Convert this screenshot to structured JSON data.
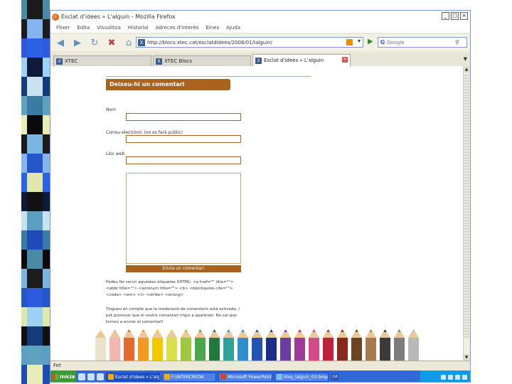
{
  "strip": {
    "colors": [
      "#4a8aa6",
      "#1c1c1c",
      "#2f5ae0",
      "#9ed2f5",
      "#163a7a",
      "#5fa2c0",
      "#e8edb8",
      "#1a1a1a",
      "#84b5f0",
      "#2b63e6",
      "#0d1a3a",
      "#c8e2f0",
      "#3a7ba3",
      "#0a0a0a",
      "#7bb6e3",
      "#2655c7",
      "#dfe8a8",
      "#111111",
      "#5d9ec3",
      "#1e4bb8"
    ]
  },
  "window": {
    "title": "Esclat d'idees » L'alguin - Mozilla Firefox",
    "controls": [
      "_",
      "□",
      "×"
    ]
  },
  "menu": [
    "Fitxer",
    "Edita",
    "Visualitza",
    "Historial",
    "Adreces d'interès",
    "Eines",
    "Ajuda"
  ],
  "nav": {
    "url": "http://blocs.xtec.cat/esclatdidees/2008/01/lalguin/",
    "search_placeholder": "Google",
    "icons": [
      "back-icon",
      "forward-icon",
      "reload-icon",
      "stop-icon",
      "home-icon"
    ]
  },
  "tabs": [
    {
      "label": "XTEC",
      "active": false
    },
    {
      "label": "XTEC Blocs",
      "active": false
    },
    {
      "label": "Esclat d'idees » L'alguin",
      "active": true
    }
  ],
  "page": {
    "comment_heading": "Deixeu-hi un comentari",
    "name_label": "Nom",
    "email_label": "Correu electrònic (no es farà públic)",
    "web_label": "Lloc web",
    "submit_label": "Envia un comentari",
    "para1": "Podeu fer servir aquestes etiquetes XHTML: <a href=\"\" title=\"\"> <abbr title=\"\"> <acronym title=\"\"> <b> <blockquote cite=\"\"> <code> <em> <i> <strike> <strong>",
    "para2": "Tingueu en compte que la moderació de comentaris està activada, i pot provocar que el vostre comentari trigui a aparèixer. No cal que torneu a enviar el comentari!"
  },
  "pencil_colors": [
    "#e9e3c8",
    "#f2b5b0",
    "#e36a2e",
    "#f39a1e",
    "#f5c900",
    "#d8e04a",
    "#a0c83c",
    "#4aa84a",
    "#1f7a3d",
    "#2fa39a",
    "#2f8dd0",
    "#2155b0",
    "#1b2f8a",
    "#6a3ea1",
    "#9c3b9a",
    "#d64a8a",
    "#c21f3a",
    "#8a2a1c",
    "#6b4422",
    "#a87b4f",
    "#3a3a3a",
    "#7d7d7d",
    "#b9b9b9"
  ],
  "statusbar": {
    "text": "Fet"
  },
  "taskbar": {
    "start_label": "Inicia",
    "tasks": [
      {
        "label": "Esclat d'idees » L'alg...",
        "active": true
      },
      {
        "label": "F:\\INTERCREDA",
        "active": false
      },
      {
        "label": "Microsoft PowerPoint...",
        "active": false
      },
      {
        "label": "blog_lalguin_03.bmp -...",
        "active": false
      }
    ],
    "lang": "CA"
  }
}
